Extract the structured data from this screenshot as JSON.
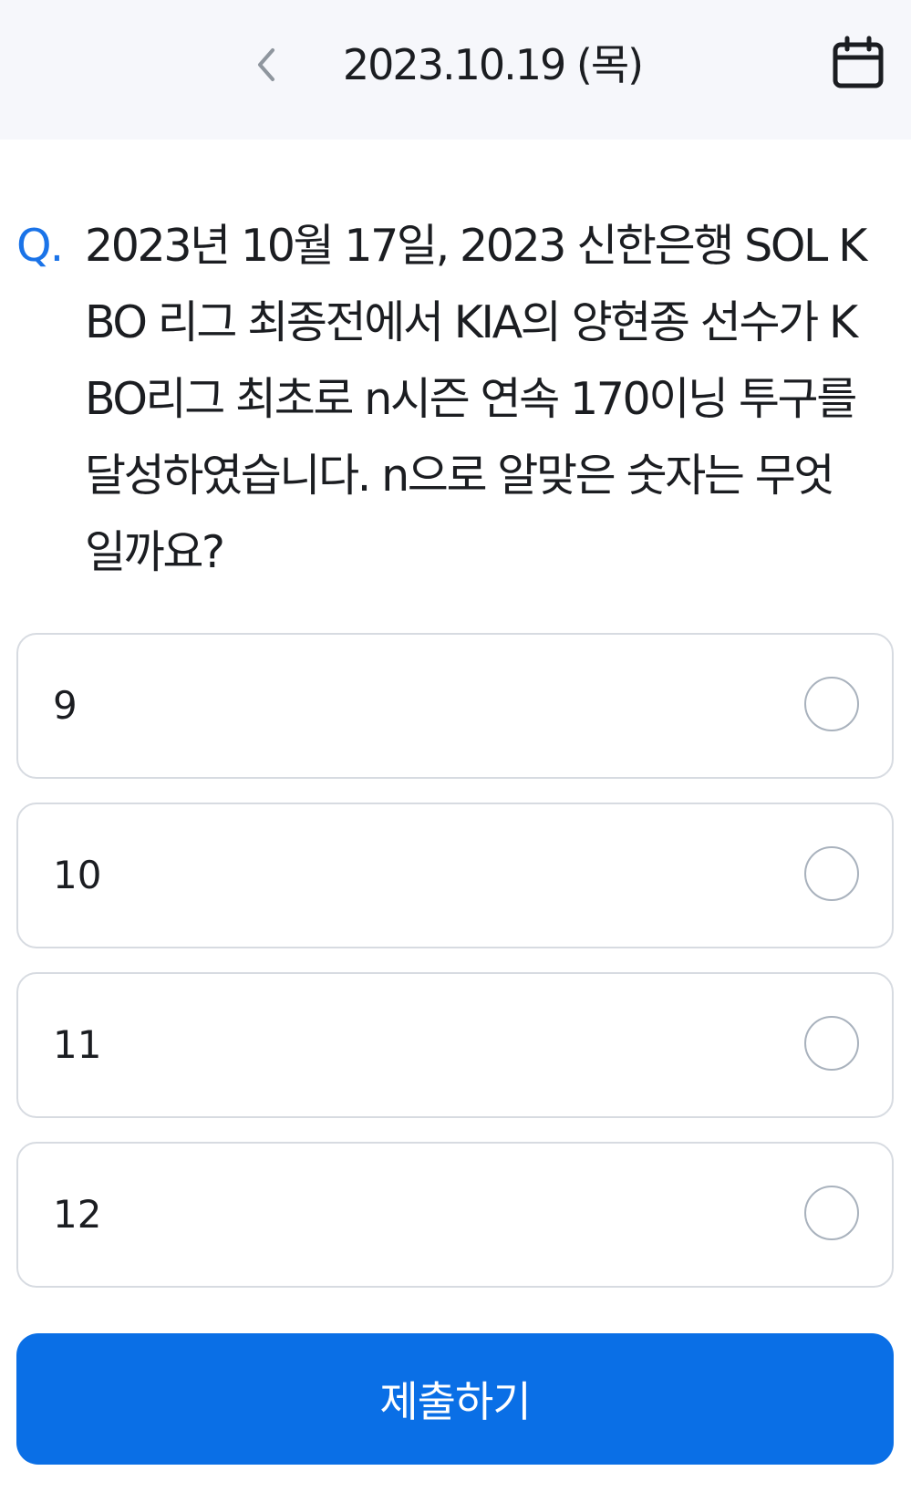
{
  "header": {
    "date_label": "2023.10.19 (목)",
    "back_icon": "chevron-left-icon",
    "calendar_icon": "calendar-icon"
  },
  "question": {
    "prefix": "Q.",
    "text": "2023년 10월 17일, 2023 신한은행 SOL KBO 리그 최종전에서 KIA의 양현종 선수가 KBO리그 최초로 n시즌 연속 170이닝 투구를 달성하였습니다. n으로 알맞은 숫자는 무엇일까요?"
  },
  "options": [
    {
      "label": "9"
    },
    {
      "label": "10"
    },
    {
      "label": "11"
    },
    {
      "label": "12"
    }
  ],
  "submit_label": "제출하기",
  "colors": {
    "accent": "#0a6fe6",
    "question_prefix": "#1a73e8",
    "header_bg": "#f6f7fb",
    "option_border": "#d7dbe1"
  }
}
